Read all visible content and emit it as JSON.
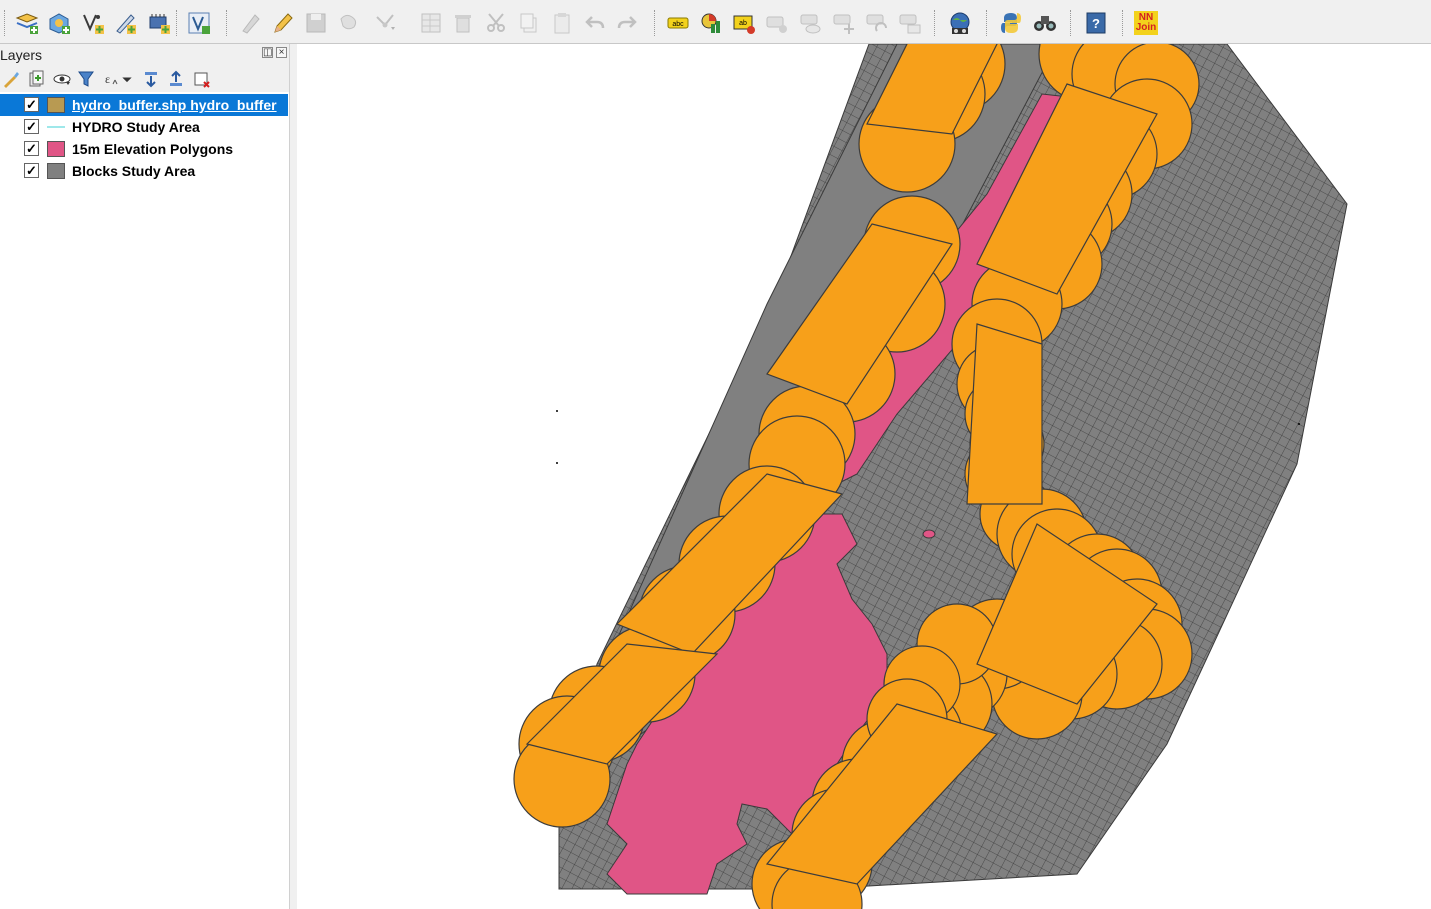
{
  "toolbar": {
    "buttons": [
      {
        "name": "add-vector-layer-icon",
        "tooltip": "Add Vector Layer",
        "enabled": true
      },
      {
        "name": "add-spatialite-icon",
        "tooltip": "Add SpatiaLite Layer",
        "enabled": true
      },
      {
        "name": "new-shapefile-icon",
        "tooltip": "New Shapefile Layer",
        "enabled": true
      },
      {
        "name": "new-gpx-icon",
        "tooltip": "Create Layer",
        "enabled": true
      },
      {
        "name": "add-wms-icon",
        "tooltip": "Add WMS Layer",
        "enabled": true
      },
      {
        "name": "add-virtual-layer-icon",
        "tooltip": "Add Virtual Layer",
        "enabled": true
      },
      {
        "name": "current-edits-icon",
        "tooltip": "Current Edits",
        "enabled": false
      },
      {
        "name": "toggle-editing-icon",
        "tooltip": "Toggle Editing",
        "enabled": true
      },
      {
        "name": "save-edits-icon",
        "tooltip": "Save Layer Edits",
        "enabled": false
      },
      {
        "name": "add-feature-icon",
        "tooltip": "Add Feature",
        "enabled": false
      },
      {
        "name": "node-tool-icon",
        "tooltip": "Node Tool",
        "enabled": false
      },
      {
        "name": "modify-attributes-icon",
        "tooltip": "Modify Attributes",
        "enabled": false
      },
      {
        "name": "delete-selected-icon",
        "tooltip": "Delete Selected",
        "enabled": false
      },
      {
        "name": "cut-features-icon",
        "tooltip": "Cut Features",
        "enabled": false
      },
      {
        "name": "copy-features-icon",
        "tooltip": "Copy Features",
        "enabled": false
      },
      {
        "name": "paste-features-icon",
        "tooltip": "Paste Features",
        "enabled": false
      },
      {
        "name": "undo-icon",
        "tooltip": "Undo",
        "enabled": false
      },
      {
        "name": "redo-icon",
        "tooltip": "Redo",
        "enabled": false
      },
      {
        "name": "label-icon",
        "tooltip": "Layer Labeling Options",
        "enabled": true
      },
      {
        "name": "diagram-icon",
        "tooltip": "Layer Diagram Options",
        "enabled": true
      },
      {
        "name": "pin-labels-icon",
        "tooltip": "Pin/Unpin Labels",
        "enabled": true
      },
      {
        "name": "highlight-pinned-labels-icon",
        "tooltip": "Highlight Pinned Labels",
        "enabled": false
      },
      {
        "name": "show-hide-labels-icon",
        "tooltip": "Show/Hide Labels",
        "enabled": false
      },
      {
        "name": "move-label-icon",
        "tooltip": "Move Label",
        "enabled": false
      },
      {
        "name": "rotate-label-icon",
        "tooltip": "Rotate Label",
        "enabled": false
      },
      {
        "name": "change-label-icon",
        "tooltip": "Change Label",
        "enabled": false
      },
      {
        "name": "georeferencer-icon",
        "tooltip": "Georeferencer",
        "enabled": true
      },
      {
        "name": "python-console-icon",
        "tooltip": "Python Console",
        "enabled": true
      },
      {
        "name": "locator-icon",
        "tooltip": "Search",
        "enabled": true
      },
      {
        "name": "help-icon",
        "tooltip": "Help",
        "enabled": true
      },
      {
        "name": "nnjoin-icon",
        "tooltip": "NNJoin",
        "enabled": true,
        "text_top": "NN",
        "text_bottom": "Join"
      }
    ]
  },
  "layers_panel": {
    "title": "Layers",
    "float_glyph": "◫",
    "close_glyph": "×",
    "tools": [
      {
        "name": "open-layer-styling-icon"
      },
      {
        "name": "add-group-icon"
      },
      {
        "name": "manage-visibility-icon"
      },
      {
        "name": "filter-legend-icon"
      },
      {
        "name": "filter-expression-icon"
      },
      {
        "name": "expand-all-icon"
      },
      {
        "name": "collapse-all-icon"
      },
      {
        "name": "remove-layer-icon"
      }
    ],
    "layers": [
      {
        "name": "hydro_buffer.shp hydro_buffer",
        "checked": true,
        "selected": true,
        "symbol": "fill",
        "color": "#b89a52"
      },
      {
        "name": "HYDRO Study Area",
        "checked": true,
        "selected": false,
        "symbol": "line",
        "color": "#9fe8ea"
      },
      {
        "name": "15m Elevation Polygons",
        "checked": true,
        "selected": false,
        "symbol": "fill",
        "color": "#e05586"
      },
      {
        "name": "Blocks Study Area",
        "checked": true,
        "selected": false,
        "symbol": "fill",
        "color": "#808080"
      }
    ],
    "check_glyph": "✓"
  },
  "map": {
    "colors": {
      "buffer": "#f7a01a",
      "elevation": "#e05586",
      "blocks": "#808080",
      "outline": "#3c3c3c"
    }
  }
}
